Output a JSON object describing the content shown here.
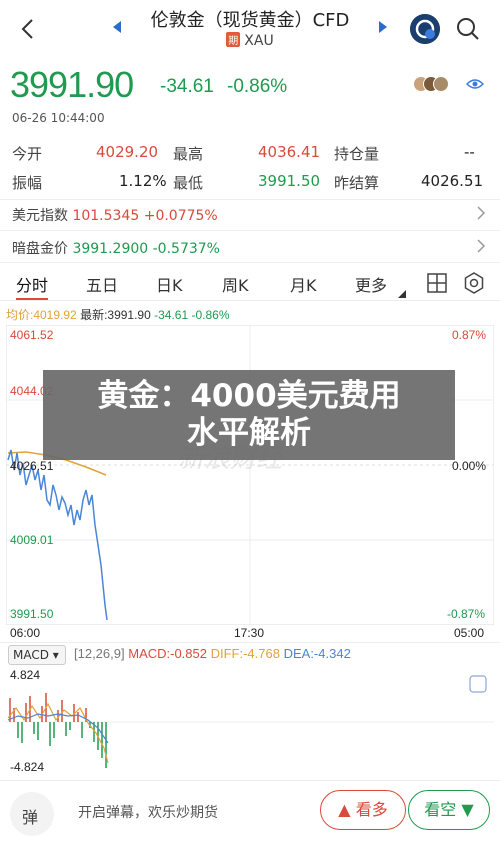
{
  "header": {
    "title": "伦敦金（现货黄金）CFD",
    "qi_badge": "期",
    "symbol": "XAU"
  },
  "quote": {
    "price": "3991.90",
    "change": "-34.61",
    "change_pct": "-0.86%",
    "timestamp": "06-26 10:44:00",
    "rows": [
      {
        "l1": "今开",
        "v1": "4029.20",
        "l2": "最高",
        "v2": "4036.41",
        "l3": "持仓量",
        "v3": "--"
      },
      {
        "l1": "振幅",
        "v1": "1.12%",
        "l2": "最低",
        "v2": "3991.50",
        "l3": "昨结算",
        "v3": "4026.51"
      }
    ]
  },
  "indices": [
    {
      "label": "美元指数",
      "value": "101.5345",
      "change": "+0.0775%"
    },
    {
      "label": "暗盘金价",
      "value": "3991.2900",
      "change": "-0.5737%"
    }
  ],
  "tabs": [
    "分时",
    "五日",
    "日K",
    "周K",
    "月K",
    "更多"
  ],
  "chart": {
    "avg_label": "均价:4019.92",
    "latest_label": "最新:3991.90",
    "latest_change": "-34.61",
    "latest_pct": "-0.86%",
    "y_labels": [
      "4061.52",
      "4044.02",
      "4026.51",
      "4009.01",
      "3991.50"
    ],
    "pct_labels": [
      "0.87%",
      "0.00%",
      "-0.87%"
    ],
    "x_labels": [
      "06:00",
      "17:30",
      "05:00"
    ],
    "watermark": "新浪财经",
    "colors": {
      "price": "#4a86d6",
      "avg": "#e0a23a",
      "up": "#d84a3a",
      "down": "#1f9a4e"
    }
  },
  "overlay": {
    "line1": "黄金：4000美元费用",
    "line2": "水平解析"
  },
  "macd": {
    "selector": "MACD",
    "params": "[12,26,9]",
    "macd": "MACD:-0.852",
    "diff": "DIFF:-4.768",
    "dea": "DEA:-4.342",
    "top": "4.824",
    "bottom": "-4.824"
  },
  "bottom_bar": {
    "danmu_icon": "弹",
    "danmu_text": "开启弹幕，欢乐炒期货",
    "bull_label": "看多",
    "bear_label": "看空"
  }
}
